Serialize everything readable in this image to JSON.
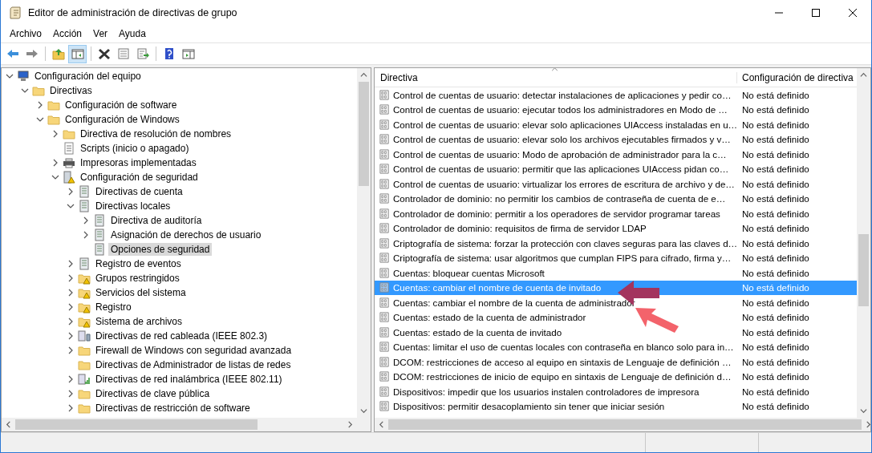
{
  "window": {
    "title": "Editor de administración de directivas de grupo"
  },
  "menu": [
    "Archivo",
    "Acción",
    "Ver",
    "Ayuda"
  ],
  "toolbar": [
    [
      {
        "kind": "back",
        "pressed": false
      },
      {
        "kind": "forward",
        "pressed": false
      }
    ],
    [
      {
        "kind": "up",
        "pressed": false
      },
      {
        "kind": "tree",
        "pressed": true
      }
    ],
    [
      {
        "kind": "delete",
        "pressed": false
      },
      {
        "kind": "properties",
        "pressed": false
      },
      {
        "kind": "export",
        "pressed": false
      }
    ],
    [
      {
        "kind": "help",
        "pressed": false
      },
      {
        "kind": "pane",
        "pressed": false
      }
    ]
  ],
  "tree": [
    {
      "label": "Configuración del equipo",
      "kind": "computer",
      "expanded": true,
      "selected": false,
      "children": [
        {
          "label": "Directivas",
          "kind": "folder",
          "expanded": true,
          "selected": false,
          "children": [
            {
              "label": "Configuración de software",
              "kind": "folder",
              "expanded": false,
              "selected": false
            },
            {
              "label": "Configuración de Windows",
              "kind": "folder",
              "expanded": true,
              "selected": false,
              "children": [
                {
                  "label": "Directiva de resolución de nombres",
                  "kind": "folder",
                  "expanded": false,
                  "selected": false
                },
                {
                  "label": "Scripts (inicio o apagado)",
                  "kind": "script",
                  "selected": false
                },
                {
                  "label": "Impresoras implementadas",
                  "kind": "printer",
                  "expanded": false,
                  "selected": false
                },
                {
                  "label": "Configuración de seguridad",
                  "kind": "security",
                  "expanded": true,
                  "selected": false,
                  "children": [
                    {
                      "label": "Directivas de cuenta",
                      "kind": "policy",
                      "expanded": false,
                      "selected": false
                    },
                    {
                      "label": "Directivas locales",
                      "kind": "policy",
                      "expanded": true,
                      "selected": false,
                      "children": [
                        {
                          "label": "Directiva de auditoría",
                          "kind": "policy",
                          "expanded": false,
                          "selected": false
                        },
                        {
                          "label": "Asignación de derechos de usuario",
                          "kind": "policy",
                          "expanded": false,
                          "selected": false
                        },
                        {
                          "label": "Opciones de seguridad",
                          "kind": "policy",
                          "selected": true
                        }
                      ]
                    },
                    {
                      "label": "Registro de eventos",
                      "kind": "policy",
                      "expanded": false,
                      "selected": false
                    },
                    {
                      "label": "Grupos restringidos",
                      "kind": "lockfolder",
                      "expanded": false,
                      "selected": false
                    },
                    {
                      "label": "Servicios del sistema",
                      "kind": "lockfolder",
                      "expanded": false,
                      "selected": false
                    },
                    {
                      "label": "Registro",
                      "kind": "lockfolder",
                      "expanded": false,
                      "selected": false
                    },
                    {
                      "label": "Sistema de archivos",
                      "kind": "lockfolder",
                      "expanded": false,
                      "selected": false
                    },
                    {
                      "label": "Directivas de red cableada (IEEE 802.3)",
                      "kind": "network",
                      "expanded": false,
                      "selected": false
                    },
                    {
                      "label": "Firewall de Windows con seguridad avanzada",
                      "kind": "folder",
                      "expanded": false,
                      "selected": false
                    },
                    {
                      "label": "Directivas de Administrador de listas de redes",
                      "kind": "folder",
                      "selected": false
                    },
                    {
                      "label": "Directivas de red inalámbrica (IEEE 802.11)",
                      "kind": "wireless",
                      "expanded": false,
                      "selected": false
                    },
                    {
                      "label": "Directivas de clave pública",
                      "kind": "folder",
                      "expanded": false,
                      "selected": false
                    },
                    {
                      "label": "Directivas de restricción de software",
                      "kind": "folder",
                      "expanded": false,
                      "selected": false
                    }
                  ]
                }
              ]
            }
          ]
        }
      ]
    }
  ],
  "table": {
    "columns": [
      "Directiva",
      "Configuración de directiva"
    ],
    "rows": [
      {
        "policy": "Control de cuentas de usuario: detectar instalaciones de aplicaciones y pedir co…",
        "setting": "No está definido",
        "selected": false
      },
      {
        "policy": "Control de cuentas de usuario: ejecutar todos los administradores en Modo de …",
        "setting": "No está definido",
        "selected": false
      },
      {
        "policy": "Control de cuentas de usuario: elevar solo aplicaciones UIAccess instaladas en u…",
        "setting": "No está definido",
        "selected": false
      },
      {
        "policy": "Control de cuentas de usuario: elevar solo los archivos ejecutables firmados y v…",
        "setting": "No está definido",
        "selected": false
      },
      {
        "policy": "Control de cuentas de usuario: Modo de aprobación de administrador para la c…",
        "setting": "No está definido",
        "selected": false
      },
      {
        "policy": "Control de cuentas de usuario: permitir que las aplicaciones UIAccess pidan co…",
        "setting": "No está definido",
        "selected": false
      },
      {
        "policy": "Control de cuentas de usuario: virtualizar los errores de escritura de archivo y de…",
        "setting": "No está definido",
        "selected": false
      },
      {
        "policy": "Controlador de dominio: no permitir los cambios de contraseña de cuenta de e…",
        "setting": "No está definido",
        "selected": false
      },
      {
        "policy": "Controlador de dominio: permitir a los operadores de servidor programar tareas",
        "setting": "No está definido",
        "selected": false
      },
      {
        "policy": "Controlador de dominio: requisitos de firma de servidor LDAP",
        "setting": "No está definido",
        "selected": false
      },
      {
        "policy": "Criptografía de sistema: forzar la protección con claves seguras para las claves d…",
        "setting": "No está definido",
        "selected": false
      },
      {
        "policy": "Criptografía de sistema: usar algoritmos que cumplan FIPS para cifrado, firma y…",
        "setting": "No está definido",
        "selected": false
      },
      {
        "policy": "Cuentas: bloquear cuentas Microsoft",
        "setting": "No está definido",
        "selected": false
      },
      {
        "policy": "Cuentas: cambiar el nombre de cuenta de invitado",
        "setting": "No está definido",
        "selected": true
      },
      {
        "policy": "Cuentas: cambiar el nombre de la cuenta de administrador",
        "setting": "No está definido",
        "selected": false
      },
      {
        "policy": "Cuentas: estado de la cuenta de administrador",
        "setting": "No está definido",
        "selected": false
      },
      {
        "policy": "Cuentas: estado de la cuenta de invitado",
        "setting": "No está definido",
        "selected": false
      },
      {
        "policy": "Cuentas: limitar el uso de cuentas locales con contraseña en blanco solo para in…",
        "setting": "No está definido",
        "selected": false
      },
      {
        "policy": "DCOM: restricciones de acceso al equipo en sintaxis de Lenguaje de definición …",
        "setting": "No está definido",
        "selected": false
      },
      {
        "policy": "DCOM: restricciones de inicio de equipo en sintaxis de Lenguaje de definición d…",
        "setting": "No está definido",
        "selected": false
      },
      {
        "policy": "Dispositivos: impedir que los usuarios instalen controladores de impresora",
        "setting": "No está definido",
        "selected": false
      },
      {
        "policy": "Dispositivos: permitir desacoplamiento sin tener que iniciar sesión",
        "setting": "No está definido",
        "selected": false
      }
    ]
  }
}
